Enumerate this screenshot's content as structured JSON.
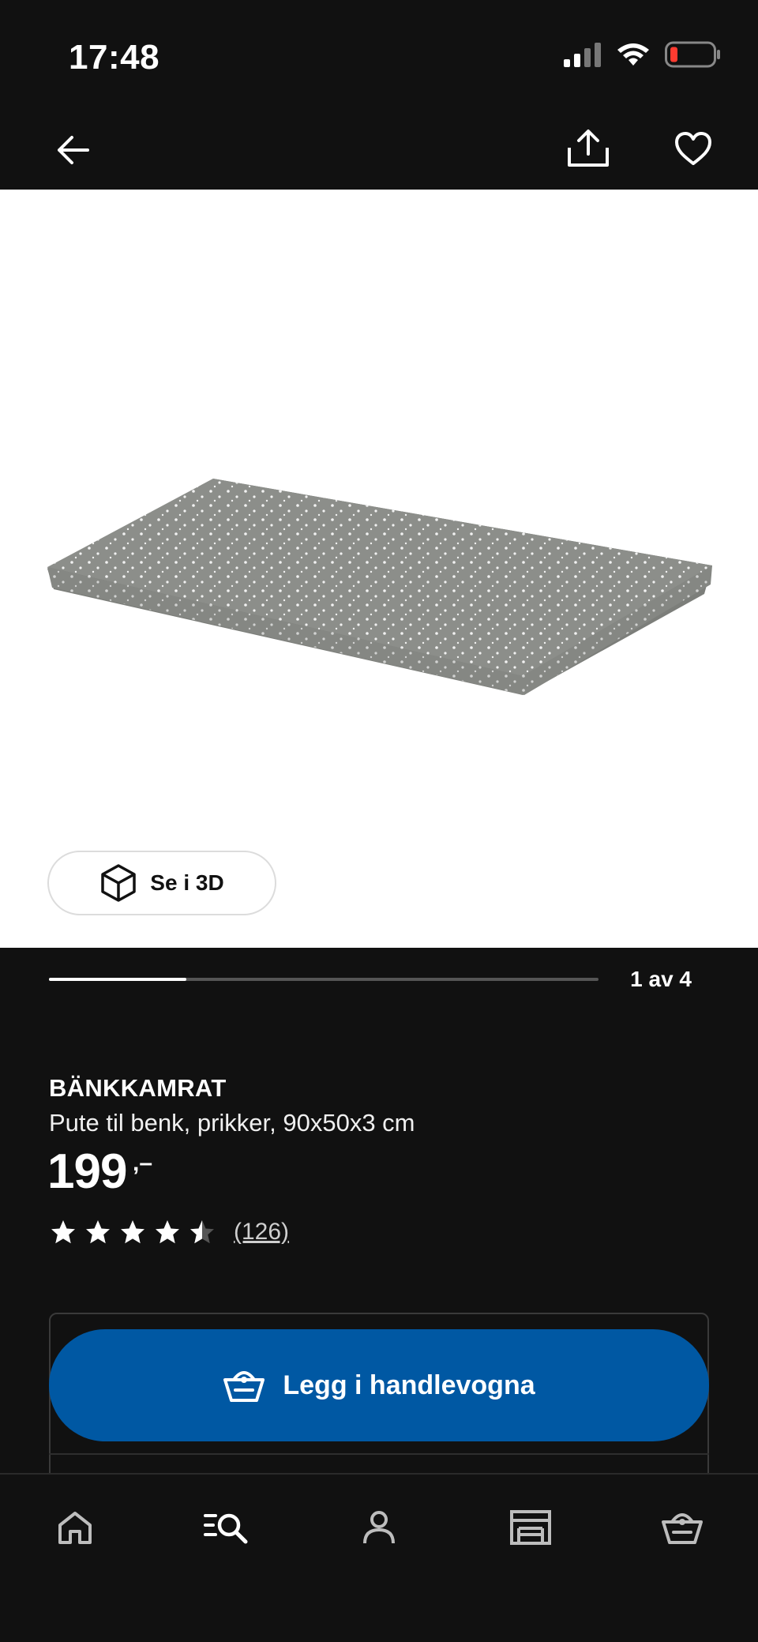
{
  "status_bar": {
    "time": "17:48"
  },
  "nav": {
    "back_icon": "arrow-left-icon",
    "share_icon": "share-icon",
    "favorite_icon": "heart-icon"
  },
  "media": {
    "view_3d_label": "Se i 3D",
    "view_3d_icon": "cube-icon",
    "counter": "1 av 4",
    "progress_fraction": 0.25
  },
  "product": {
    "name": "BÄNKKAMRAT",
    "description": "Pute til benk, prikker, 90x50x3 cm",
    "price": "199",
    "price_suffix": ",–",
    "rating": 4.5,
    "review_count": "(126)"
  },
  "cart": {
    "add_label": "Legg i handlevogna",
    "icon": "basket-icon"
  },
  "colors": {
    "background": "#111111",
    "accent_blue": "#0058a3",
    "cushion_gray": "#8a8c88"
  },
  "tabs": [
    {
      "name": "home",
      "icon": "home-icon"
    },
    {
      "name": "search",
      "icon": "search-list-icon"
    },
    {
      "name": "profile",
      "icon": "person-icon"
    },
    {
      "name": "store",
      "icon": "store-icon"
    },
    {
      "name": "cart",
      "icon": "basket-icon"
    }
  ]
}
